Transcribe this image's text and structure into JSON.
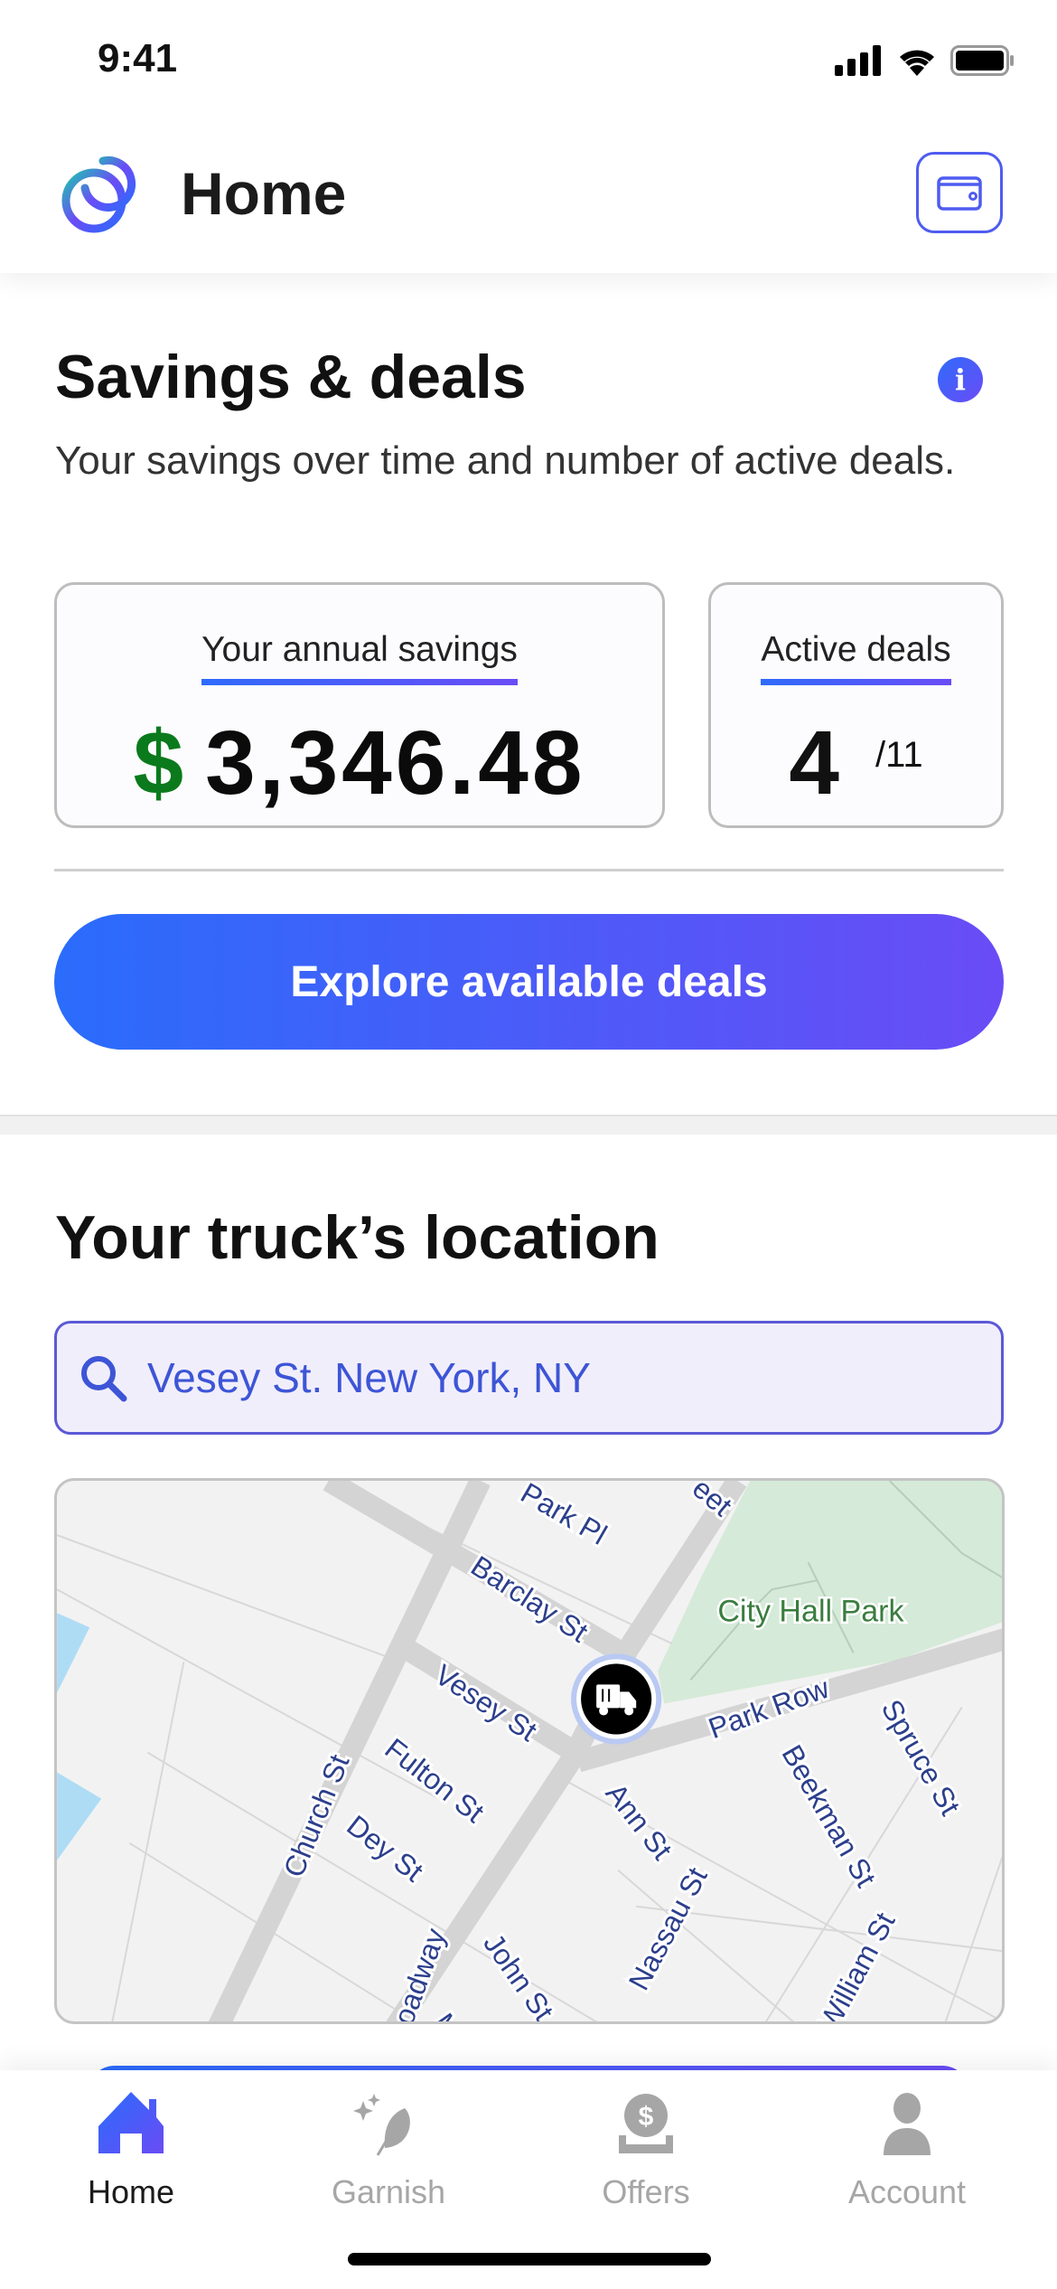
{
  "status_bar": {
    "time": "9:41"
  },
  "header": {
    "title": "Home",
    "logo_icon": "ring-logo-icon",
    "wallet_icon": "wallet-icon"
  },
  "savings": {
    "title": "Savings & deals",
    "subtitle": "Your savings over time and number of active deals.",
    "annual_label": "Your annual savings",
    "currency": "$",
    "annual_value": "3,346.48",
    "active_label": "Active deals",
    "active_value": "4",
    "active_total": "/11",
    "explore_button": "Explore available deals"
  },
  "location": {
    "title": "Your truck’s location",
    "search_value": "Vesey St. New York, NY",
    "map": {
      "park_label": "City Hall Park",
      "streets": [
        "Park Pl",
        "Barclay St",
        "Vesey St",
        "Park Row",
        "Church St",
        "Fulton St",
        "Dey St",
        "Ann St",
        "Beekman St",
        "Spruce St",
        "Nassau St",
        "John St",
        "oadway",
        "William St",
        "eet",
        "M"
      ],
      "marker_icon": "food-truck-icon"
    }
  },
  "tabs": [
    {
      "label": "Home",
      "icon": "home-icon",
      "active": true
    },
    {
      "label": "Garnish",
      "icon": "sparkle-leaf-icon",
      "active": false
    },
    {
      "label": "Offers",
      "icon": "dollar-coin-icon",
      "active": false
    },
    {
      "label": "Account",
      "icon": "person-icon",
      "active": false
    }
  ],
  "colors": {
    "accent_start": "#2a6cfb",
    "accent_end": "#6a4cf6",
    "savings_green": "#0b7a1c",
    "inactive_tab": "#a6a6a6"
  }
}
